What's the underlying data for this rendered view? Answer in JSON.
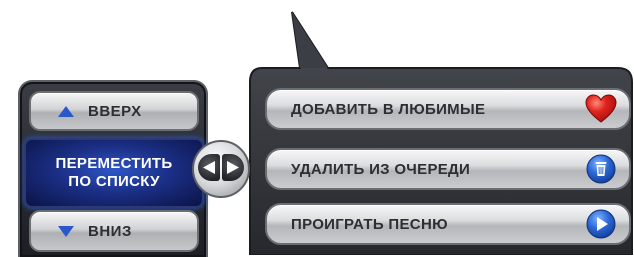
{
  "left_panel": {
    "up_label": "ВВЕРХ",
    "move_label_line1": "ПЕРЕМЕСТИТЬ",
    "move_label_line2": "ПО СПИСКУ",
    "down_label": "ВНИЗ"
  },
  "actions": {
    "favorite_label": "ДОБАВИТЬ В ЛЮБИМЫЕ",
    "favorite_icon": "heart-icon",
    "remove_label": "УДАЛИТЬ ИЗ ОЧЕРЕДИ",
    "remove_icon": "trash-icon",
    "play_label": "ПРОИГРАТЬ ПЕСНЮ",
    "play_icon": "play-icon"
  },
  "colors": {
    "accent_blue": "#1e3da8",
    "heart_red": "#d61a1a",
    "icon_blue": "#2f6fd6",
    "panel_dark": "#24262b"
  }
}
